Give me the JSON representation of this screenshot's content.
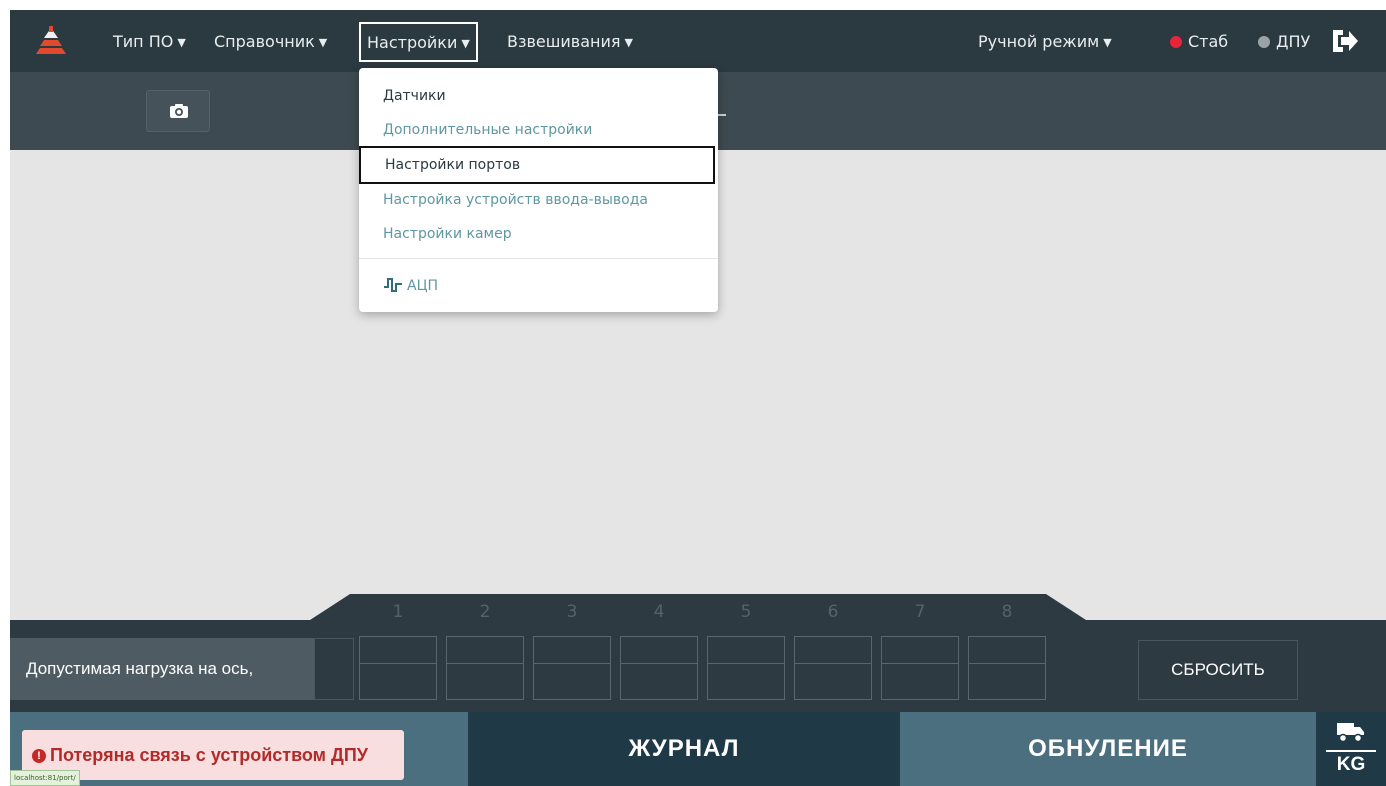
{
  "navbar": {
    "menus": [
      {
        "label": "Тип ПО"
      },
      {
        "label": "Справочник"
      },
      {
        "label": "Настройки"
      },
      {
        "label": "Взвешивания"
      }
    ],
    "mode_label": "Ручной режим",
    "indicators": [
      {
        "label": "Стаб",
        "color": "#e8243a"
      },
      {
        "label": "ДПУ",
        "color": "#9aa3a8"
      }
    ]
  },
  "settings_menu": {
    "items": [
      {
        "label": "Датчики"
      },
      {
        "label": "Дополнительные настройки"
      },
      {
        "label": "Настройки портов"
      },
      {
        "label": "Настройка устройств ввода-вывода"
      },
      {
        "label": "Настройки камер"
      }
    ],
    "adc_label": "АЦП"
  },
  "axles": {
    "numbers": [
      "1",
      "2",
      "3",
      "4",
      "5",
      "6",
      "7",
      "8"
    ],
    "load_label": "Допустимая нагрузка на ось,",
    "reset_label": "СБРОСИТЬ"
  },
  "footer": {
    "alert_text": "Потеряна связь с устройством ДПУ",
    "url_hint": "localhost:81/port/",
    "journal_label": "ЖУРНАЛ",
    "zero_label": "ОБНУЛЕНИЕ",
    "unit_label": "KG"
  },
  "colors": {
    "navbar": "#2b3940",
    "toolbar": "#3e4a51",
    "workspace": "#e5e5e5",
    "footer_teal": "#4b6f7e",
    "footer_dark": "#1f3a46",
    "alert_text": "#b22b2b",
    "menu_link": "#5f97a2"
  }
}
